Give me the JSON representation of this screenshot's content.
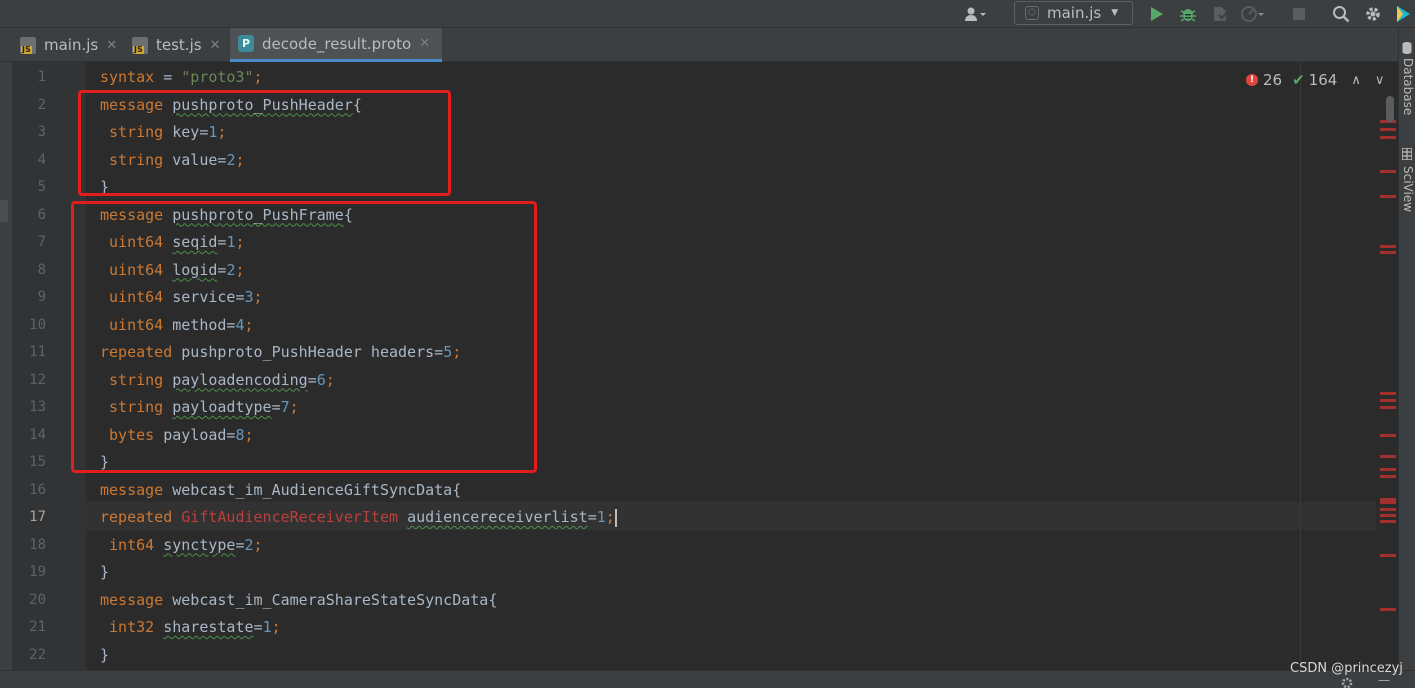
{
  "toolbar": {
    "run_config": "main.js",
    "user_icon": "user-icon",
    "run_icon": "run-icon",
    "debug_icon": "debug-icon",
    "search_icon": "search-icon",
    "settings_icon": "gear-icon"
  },
  "tabs": [
    {
      "label": "main.js",
      "type": "js"
    },
    {
      "label": "test.js",
      "type": "js"
    },
    {
      "label": "decode_result.proto",
      "type": "proto",
      "active": true
    }
  ],
  "inspection": {
    "errors": "26",
    "ok": "164"
  },
  "current_line": "17",
  "code": [
    {
      "n": "1",
      "tokens": [
        [
          "kw",
          "syntax"
        ],
        [
          "id",
          " = "
        ],
        [
          "str",
          "\"proto3\""
        ],
        [
          "kw",
          ";"
        ]
      ]
    },
    {
      "n": "2",
      "tokens": [
        [
          "kw",
          "message"
        ],
        [
          "id",
          " "
        ],
        [
          "id typo",
          "pushproto_PushHeader"
        ],
        [
          "id",
          "{"
        ]
      ]
    },
    {
      "n": "3",
      "tokens": [
        [
          "kw",
          " string"
        ],
        [
          "id",
          " key="
        ],
        [
          "num",
          "1"
        ],
        [
          "kw",
          ";"
        ]
      ]
    },
    {
      "n": "4",
      "tokens": [
        [
          "kw",
          " string"
        ],
        [
          "id",
          " value="
        ],
        [
          "num",
          "2"
        ],
        [
          "kw",
          ";"
        ]
      ]
    },
    {
      "n": "5",
      "tokens": [
        [
          "id",
          "}"
        ]
      ]
    },
    {
      "n": "6",
      "tokens": [
        [
          "kw",
          "message"
        ],
        [
          "id",
          " "
        ],
        [
          "id typo",
          "pushproto_PushFrame"
        ],
        [
          "id",
          "{"
        ]
      ]
    },
    {
      "n": "7",
      "tokens": [
        [
          "kw",
          " uint64"
        ],
        [
          "id",
          " "
        ],
        [
          "id typo",
          "seqid"
        ],
        [
          "id",
          "="
        ],
        [
          "num",
          "1"
        ],
        [
          "kw",
          ";"
        ]
      ]
    },
    {
      "n": "8",
      "tokens": [
        [
          "kw",
          " uint64"
        ],
        [
          "id",
          " "
        ],
        [
          "id typo",
          "logid"
        ],
        [
          "id",
          "="
        ],
        [
          "num",
          "2"
        ],
        [
          "kw",
          ";"
        ]
      ]
    },
    {
      "n": "9",
      "tokens": [
        [
          "kw",
          " uint64"
        ],
        [
          "id",
          " service="
        ],
        [
          "num",
          "3"
        ],
        [
          "kw",
          ";"
        ]
      ]
    },
    {
      "n": "10",
      "tokens": [
        [
          "kw",
          " uint64"
        ],
        [
          "id",
          " method="
        ],
        [
          "num",
          "4"
        ],
        [
          "kw",
          ";"
        ]
      ]
    },
    {
      "n": "11",
      "tokens": [
        [
          "kw",
          "repeated"
        ],
        [
          "id",
          " pushproto_PushHeader headers="
        ],
        [
          "num",
          "5"
        ],
        [
          "kw",
          ";"
        ]
      ]
    },
    {
      "n": "12",
      "tokens": [
        [
          "kw",
          " string"
        ],
        [
          "id",
          " "
        ],
        [
          "id typo",
          "payloadencoding"
        ],
        [
          "id",
          "="
        ],
        [
          "num",
          "6"
        ],
        [
          "kw",
          ";"
        ]
      ]
    },
    {
      "n": "13",
      "tokens": [
        [
          "kw",
          " string"
        ],
        [
          "id",
          " "
        ],
        [
          "id typo",
          "payloadtype"
        ],
        [
          "id",
          "="
        ],
        [
          "num",
          "7"
        ],
        [
          "kw",
          ";"
        ]
      ]
    },
    {
      "n": "14",
      "tokens": [
        [
          "kw",
          " bytes"
        ],
        [
          "id",
          " payload="
        ],
        [
          "num",
          "8"
        ],
        [
          "kw",
          ";"
        ]
      ]
    },
    {
      "n": "15",
      "tokens": [
        [
          "id",
          "}"
        ]
      ]
    },
    {
      "n": "16",
      "tokens": [
        [
          "kw",
          "message"
        ],
        [
          "id",
          " webcast_im_AudienceGiftSyncData{"
        ]
      ]
    },
    {
      "n": "17",
      "tokens": [
        [
          "kw",
          "repeated"
        ],
        [
          "id",
          " "
        ],
        [
          "err",
          "GiftAudienceReceiverItem"
        ],
        [
          "id",
          " "
        ],
        [
          "id typo",
          "audiencereceiverlist"
        ],
        [
          "id",
          "="
        ],
        [
          "num",
          "1"
        ],
        [
          "kw",
          ";"
        ]
      ]
    },
    {
      "n": "18",
      "tokens": [
        [
          "kw",
          " int64"
        ],
        [
          "id",
          " "
        ],
        [
          "id typo",
          "synctype"
        ],
        [
          "id",
          "="
        ],
        [
          "num",
          "2"
        ],
        [
          "kw",
          ";"
        ]
      ]
    },
    {
      "n": "19",
      "tokens": [
        [
          "id",
          "}"
        ]
      ]
    },
    {
      "n": "20",
      "tokens": [
        [
          "kw",
          "message"
        ],
        [
          "id",
          " webcast_im_CameraShareStateSyncData{"
        ]
      ]
    },
    {
      "n": "21",
      "tokens": [
        [
          "kw",
          " int32"
        ],
        [
          "id",
          " "
        ],
        [
          "id typo",
          "sharestate"
        ],
        [
          "id",
          "="
        ],
        [
          "num",
          "1"
        ],
        [
          "kw",
          ";"
        ]
      ]
    },
    {
      "n": "22",
      "tokens": [
        [
          "id",
          "}"
        ]
      ]
    }
  ],
  "side_panels": [
    "Database",
    "SciView"
  ],
  "watermark": "CSDN @princezyj",
  "colors": {
    "keyword": "#cc7832",
    "string": "#6a8759",
    "number": "#6897bb",
    "error": "#bc3f3c",
    "highlight_box": "#e01e1e"
  }
}
